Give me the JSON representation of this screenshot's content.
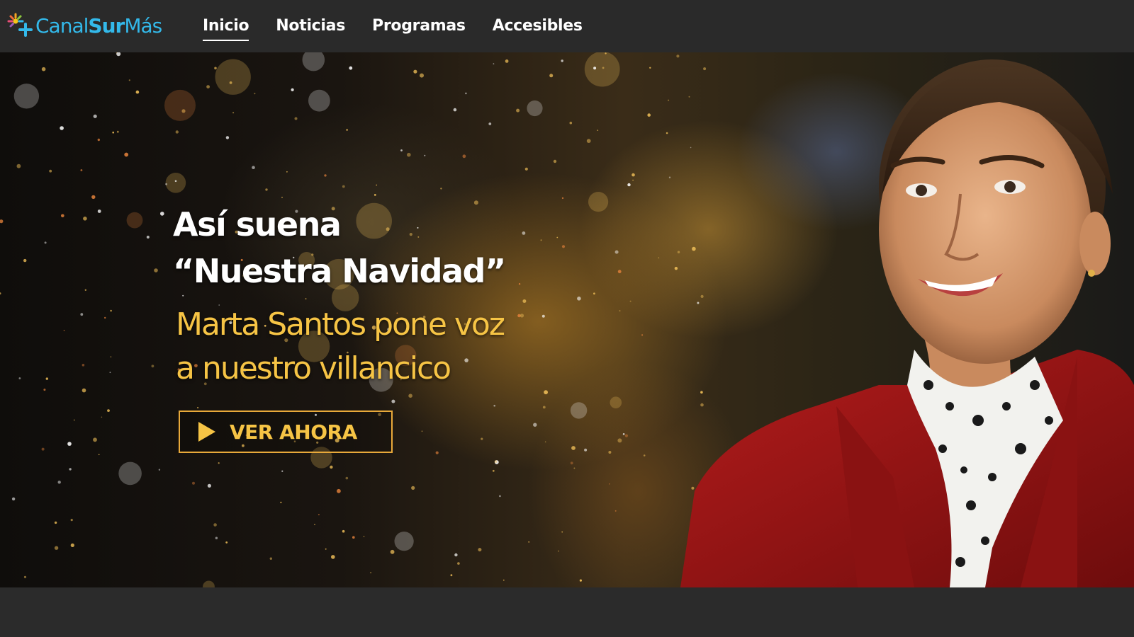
{
  "brand": {
    "name_part1": "Canal",
    "name_part2": "Sur",
    "name_part3": "Más",
    "logo_icon": "sun-plus-icon",
    "color": "#33b9ea"
  },
  "nav": {
    "items": [
      {
        "label": "Inicio",
        "active": true
      },
      {
        "label": "Noticias",
        "active": false
      },
      {
        "label": "Programas",
        "active": false
      },
      {
        "label": "Accesibles",
        "active": false
      }
    ]
  },
  "hero": {
    "headline_line1": "Así suena",
    "headline_line2": "“Nuestra Navidad”",
    "subline_line1": "Marta Santos pone voz",
    "subline_line2": "a nuestro villancico",
    "cta_label": "VER AHORA",
    "cta_icon": "play-icon",
    "accent_color": "#f6c445"
  }
}
